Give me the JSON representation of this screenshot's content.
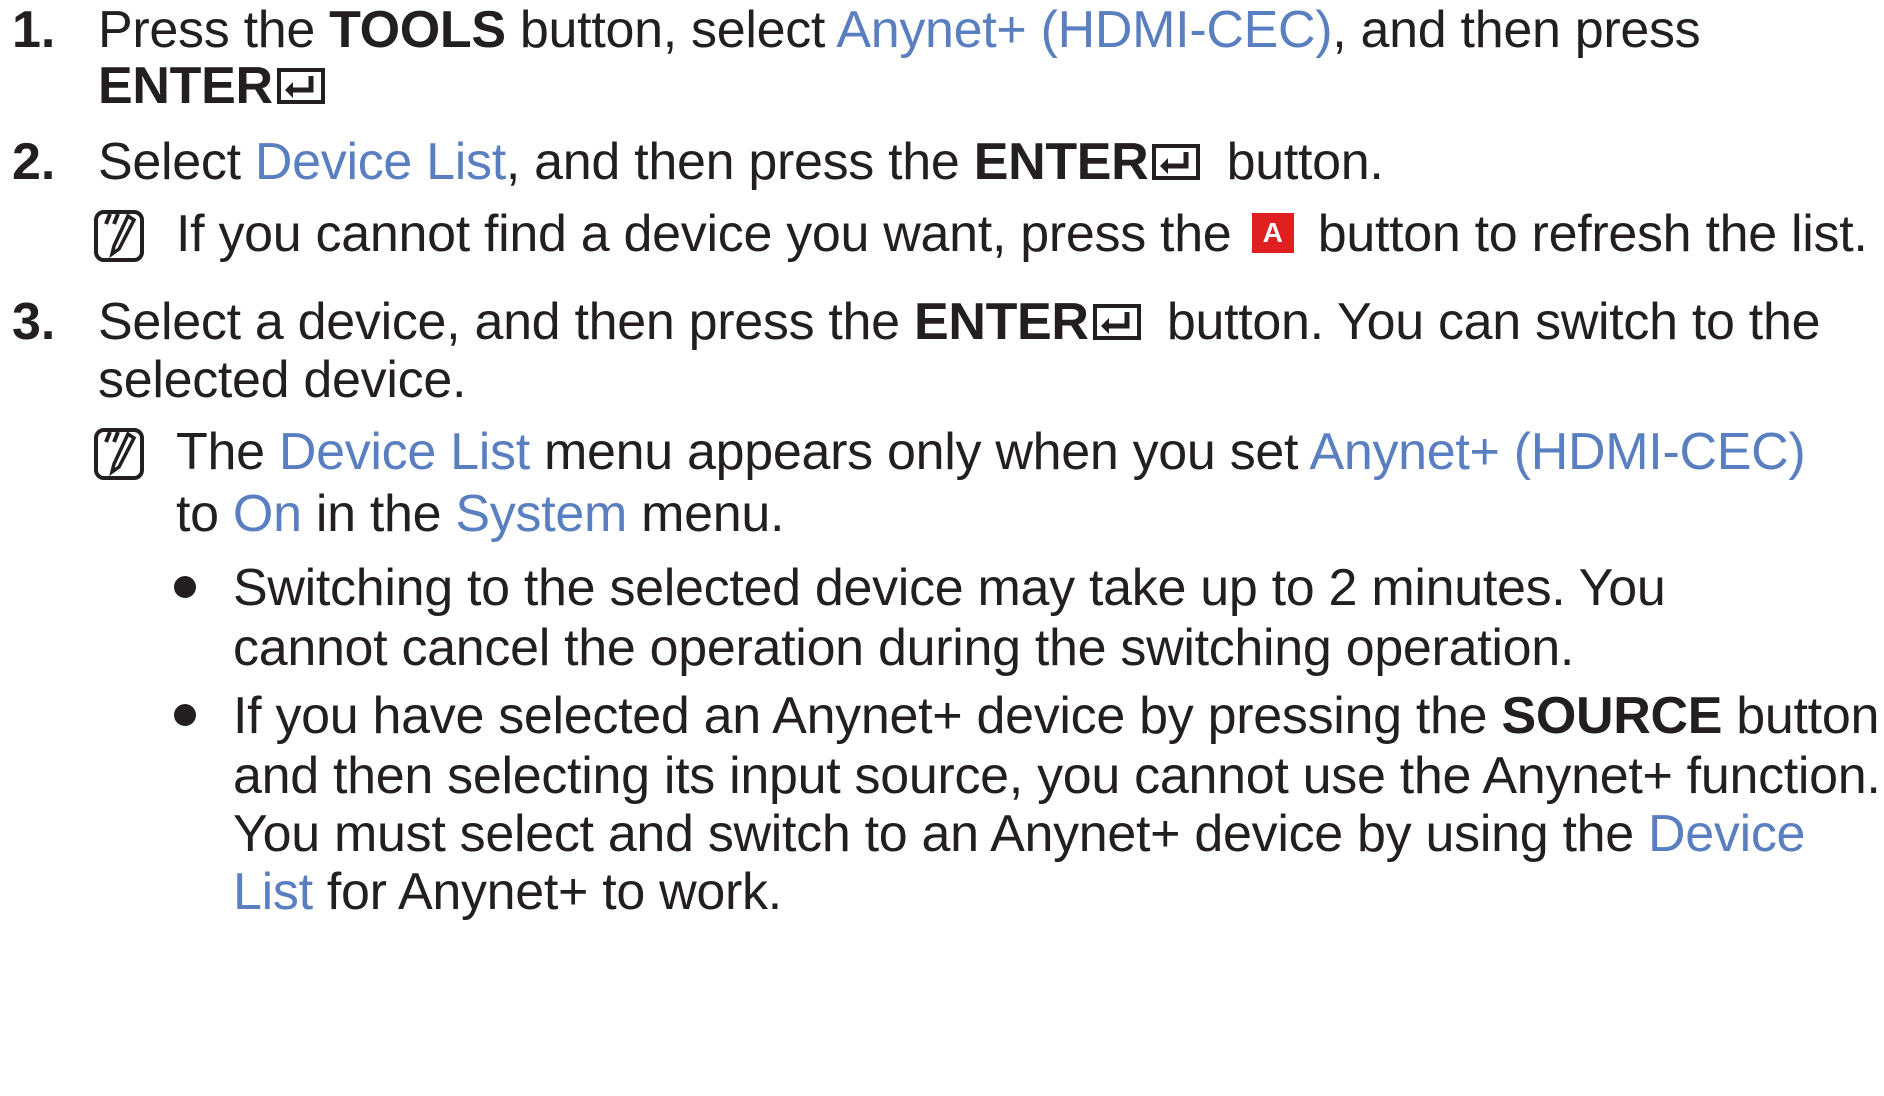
{
  "steps": [
    {
      "number": "1.",
      "lines": [
        {
          "t1": "Press the ",
          "b1": "TOOLS",
          "t2": " button, select ",
          "l1": "Anynet+ (HDMI-CEC)",
          "t3": ", and then press"
        },
        {
          "b1": "ENTER"
        }
      ]
    },
    {
      "number": "2.",
      "line": {
        "t1": "Select ",
        "l1": "Device List",
        "t2": ", and then press the ",
        "b1": "ENTER",
        "t3": " button."
      },
      "note": {
        "t1": "If you cannot find a device you want, press the ",
        "button": "A",
        "t2": " button to refresh the list."
      }
    },
    {
      "number": "3.",
      "lines": [
        {
          "t1": "Select a device, and then press the ",
          "b1": "ENTER",
          "t2": " button. You can switch to the"
        },
        {
          "t1": "selected device."
        }
      ],
      "note": {
        "line1": {
          "t1": "The ",
          "l1": "Device List",
          "t2": " menu appears only when you set ",
          "l2": "Anynet+ (HDMI-CEC)"
        },
        "line2": {
          "t1": "to ",
          "l1": "On",
          "t2": " in the ",
          "l2": "System",
          "t3": " menu."
        }
      },
      "bullets": [
        {
          "lines": [
            {
              "t1": "Switching to the selected device may take up to 2 minutes. You"
            },
            {
              "t1": "cannot cancel the operation during the switching operation."
            }
          ]
        },
        {
          "lines": [
            {
              "t1": "If you have selected an Anynet+ device by pressing the ",
              "b1": "SOURCE",
              "t2": " button"
            },
            {
              "t1": "and then selecting its input source, you cannot use the Anynet+ function."
            },
            {
              "t1": "You must select and switch to an Anynet+ device by using the ",
              "l1": "Device"
            },
            {
              "l1": "List",
              "t1": " for Anynet+ to work."
            }
          ]
        }
      ]
    }
  ],
  "colors": {
    "link": "#5a7fc0",
    "text": "#231f20",
    "a_button": "#e02020"
  },
  "icons": {
    "enter": "enter-icon",
    "note": "note-icon"
  }
}
